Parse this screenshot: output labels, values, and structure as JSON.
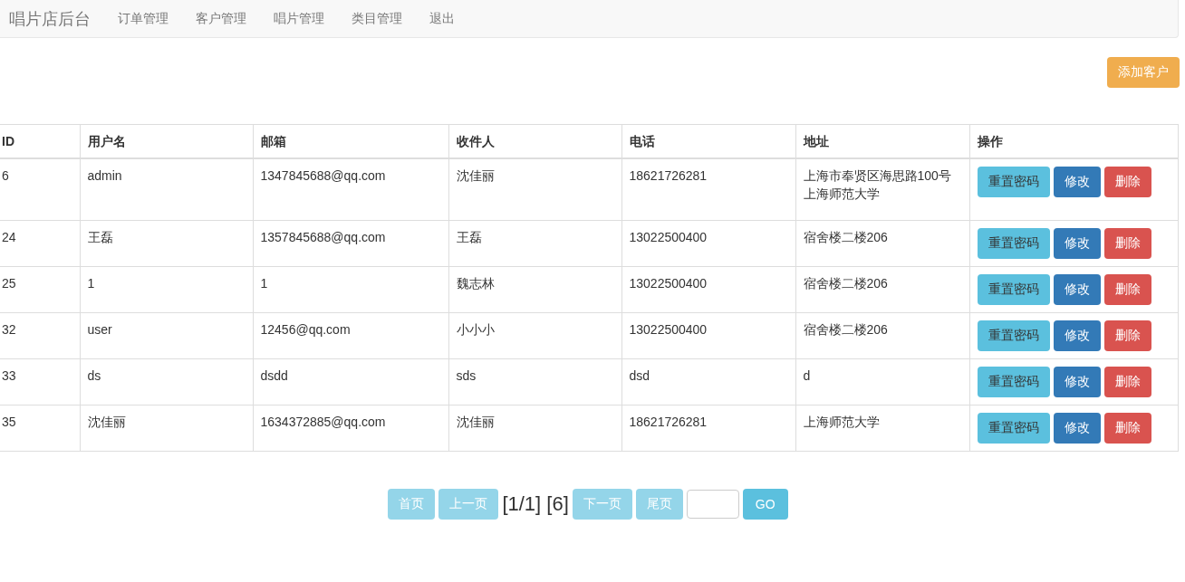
{
  "navbar": {
    "brand": "唱片店后台",
    "items": [
      "订单管理",
      "客户管理",
      "唱片管理",
      "类目管理",
      "退出"
    ]
  },
  "add_button": "添加客户",
  "table": {
    "columns": [
      "ID",
      "用户名",
      "邮箱",
      "收件人",
      "电话",
      "地址",
      "操作"
    ],
    "rows": [
      {
        "cells": [
          "6",
          "admin",
          "1347845688@qq.com",
          "沈佳丽",
          "18621726281",
          "上海市奉贤区海思路100号上海师范大学"
        ],
        "actions": [
          "重置密码",
          "修改",
          "删除"
        ]
      },
      {
        "cells": [
          "24",
          "王磊",
          "1357845688@qq.com",
          "王磊",
          "13022500400",
          "宿舍楼二楼206"
        ],
        "actions": [
          "重置密码",
          "修改",
          "删除"
        ]
      },
      {
        "cells": [
          "25",
          "1",
          "1",
          "魏志林",
          "13022500400",
          "宿舍楼二楼206"
        ],
        "actions": [
          "重置密码",
          "修改",
          "删除"
        ]
      },
      {
        "cells": [
          "32",
          "user",
          "12456@qq.com",
          "小小小",
          "13022500400",
          "宿舍楼二楼206"
        ],
        "actions": [
          "重置密码",
          "修改",
          "删除"
        ]
      },
      {
        "cells": [
          "33",
          "ds",
          "dsdd",
          "sds",
          "dsd",
          "d"
        ],
        "actions": [
          "重置密码",
          "修改",
          "删除"
        ]
      },
      {
        "cells": [
          "35",
          "沈佳丽",
          "1634372885@qq.com",
          "沈佳丽",
          "18621726281",
          "上海师范大学"
        ],
        "actions": [
          "重置密码",
          "修改",
          "删除"
        ]
      }
    ]
  },
  "pagination": {
    "first": {
      "label": "首页",
      "disabled": true
    },
    "prev": {
      "label": "上一页",
      "disabled": true
    },
    "info": "[1/1] [6]",
    "next": {
      "label": "下一页",
      "disabled": true
    },
    "last": {
      "label": "尾页",
      "disabled": true
    },
    "go": "GO"
  }
}
